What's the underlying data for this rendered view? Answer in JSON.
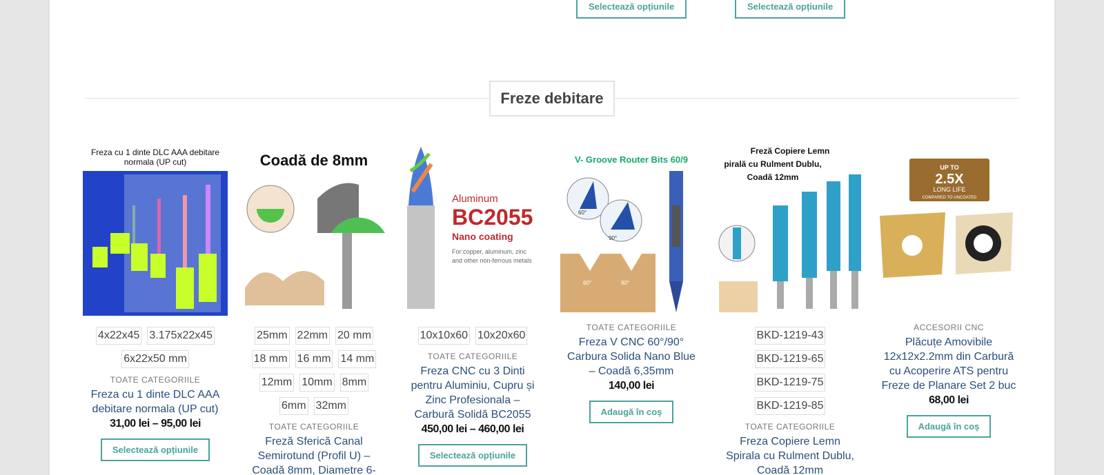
{
  "top_buttons": [
    "Selectează opțiunile",
    "Selectează opțiunile"
  ],
  "section": {
    "title": "Freze debitare"
  },
  "products": [
    {
      "image_text": [
        "Freza cu 1 dinte DLC AAA debitare",
        "normala (UP cut)"
      ],
      "options": [
        "4x22x45",
        "3.175x22x45",
        "6x22x50 mm"
      ],
      "category": "TOATE CATEGORIILE",
      "name": "Freza cu 1 dinte DLC AAA debitare normala (UP cut)",
      "price": "31,00 lei – 95,00 lei",
      "button": "Selectează opțiunile"
    },
    {
      "image_text": [
        "Coadă de 8mm"
      ],
      "options": [
        "25mm",
        "22mm",
        "20 mm",
        "18 mm",
        "16 mm",
        "14 mm",
        "12mm",
        "10mm",
        "8mm",
        "6mm",
        "32mm"
      ],
      "category": "TOATE CATEGORIILE",
      "name": "Freză Sferică Canal Semirotund (Profil U) – Coadă 8mm, Diametre 6-",
      "price": "",
      "button": ""
    },
    {
      "image_text": [
        "Aluminum",
        "BC2055",
        "Nano coating",
        "For:copper, aluminum, zinc",
        "and other non-ferrous metals"
      ],
      "options": [
        "10x10x60",
        "10x20x60"
      ],
      "category": "TOATE CATEGORIILE",
      "name": "Freza CNC cu 3 Dinti pentru Aluminiu, Cupru și Zinc Profesionala – Carbură Solidă BC2055",
      "price": "450,00 lei – 460,00 lei",
      "button": "Selectează opțiunile"
    },
    {
      "image_text": [
        "V- Groove Router Bits 60/9",
        "60°",
        "90°",
        "60°",
        "90°"
      ],
      "options": [],
      "category": "TOATE CATEGORIILE",
      "name": "Freza V CNC 60°/90° Carbura Solida Nano Blue – Coadă 6,35mm",
      "price": "140,00 lei",
      "button": "Adaugă în coș"
    },
    {
      "image_text": [
        "Freză Copiere Lemn",
        "pirală cu Rulment Dublu,",
        "Coadă 12mm"
      ],
      "options": [
        "BKD-1219-43",
        "BKD-1219-65",
        "BKD-1219-75",
        "BKD-1219-85"
      ],
      "category": "TOATE CATEGORIILE",
      "name": "Freza Copiere Lemn Spirala cu Rulment Dublu, Coadă 12mm",
      "price": "",
      "button": ""
    },
    {
      "image_text": [
        "UP TO",
        "2.5X",
        "LONG LIFE",
        "COMPARED TO UNCOATED"
      ],
      "options": [],
      "category": "ACCESORII CNC",
      "name": "Plăcuțe Amovibile 12x12x2.2mm din Carbură cu Acoperire ATS pentru Freze de Planare Set 2 buc",
      "price": "68,00 lei",
      "button": "Adaugă în coș"
    }
  ]
}
